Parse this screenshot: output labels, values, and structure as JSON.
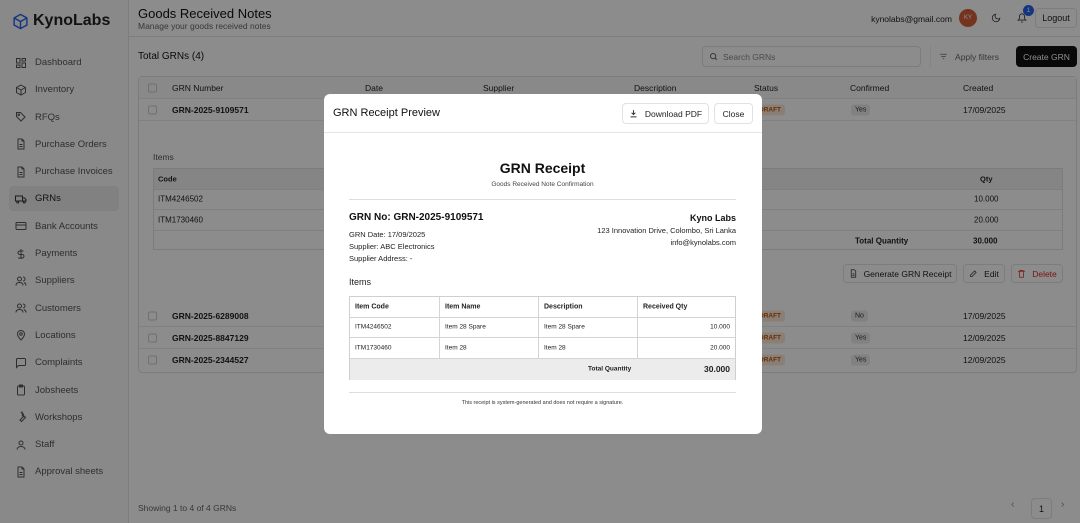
{
  "app": {
    "name": "KynoLabs"
  },
  "sidebar": {
    "items": [
      {
        "label": "Dashboard",
        "icon": "grid-icon"
      },
      {
        "label": "Inventory",
        "icon": "box-icon"
      },
      {
        "label": "RFQs",
        "icon": "tag-icon"
      },
      {
        "label": "Purchase Orders",
        "icon": "document-icon"
      },
      {
        "label": "Purchase Invoices",
        "icon": "document-icon"
      },
      {
        "label": "GRNs",
        "icon": "truck-icon",
        "active": true
      },
      {
        "label": "Bank Accounts",
        "icon": "card-icon"
      },
      {
        "label": "Payments",
        "icon": "dollar-icon"
      },
      {
        "label": "Suppliers",
        "icon": "users-icon"
      },
      {
        "label": "Customers",
        "icon": "users-icon"
      },
      {
        "label": "Locations",
        "icon": "pin-icon"
      },
      {
        "label": "Complaints",
        "icon": "chat-icon"
      },
      {
        "label": "Jobsheets",
        "icon": "clipboard-icon"
      },
      {
        "label": "Workshops",
        "icon": "wrench-icon"
      },
      {
        "label": "Staff",
        "icon": "user-icon"
      },
      {
        "label": "Approval sheets",
        "icon": "document-icon"
      }
    ]
  },
  "header": {
    "title": "Goods Received Notes",
    "subtitle": "Manage your goods received notes",
    "email": "kynolabs@gmail.com",
    "avatar_initials": "KY",
    "notification_count": "1",
    "logout_label": "Logout"
  },
  "toolbar": {
    "title": "Total GRNs (4)",
    "search_placeholder": "Search GRNs",
    "filters_label": "Apply filters",
    "create_label": "Create GRN"
  },
  "table": {
    "columns": [
      "GRN Number",
      "Date",
      "Supplier",
      "Description",
      "Status",
      "Confirmed",
      "Created"
    ],
    "rows": [
      {
        "grn": "GRN-2025-9109571",
        "status": "DRAFT",
        "confirmed": "Yes",
        "created": "17/09/2025"
      },
      {
        "grn": "GRN-2025-6289008",
        "status": "DRAFT",
        "confirmed": "No",
        "created": "17/09/2025"
      },
      {
        "grn": "GRN-2025-8847129",
        "status": "DRAFT",
        "confirmed": "Yes",
        "created": "12/09/2025"
      },
      {
        "grn": "GRN-2025-2344527",
        "status": "DRAFT",
        "confirmed": "Yes",
        "created": "12/09/2025"
      }
    ]
  },
  "expanded": {
    "items_label": "Items",
    "columns": [
      "Code",
      "Qty"
    ],
    "rows": [
      {
        "code": "ITM4246502",
        "qty": "10.000"
      },
      {
        "code": "ITM1730460",
        "qty": "20.000"
      }
    ],
    "total_label": "Total Quantity",
    "total_value": "30.000",
    "actions": {
      "generate": "Generate GRN Receipt",
      "edit": "Edit",
      "delete": "Delete"
    }
  },
  "footer": {
    "showing": "Showing 1 to 4 of 4 GRNs",
    "page": "1"
  },
  "modal": {
    "title": "GRN Receipt Preview",
    "download_label": "Download PDF",
    "close_label": "Close",
    "receipt": {
      "title": "GRN Receipt",
      "subtitle": "Goods Received Note Confirmation",
      "grn_no": "GRN No: GRN-2025-9109571",
      "grn_date": "GRN Date: 17/09/2025",
      "supplier": "Supplier: ABC Electronics",
      "supplier_address": "Supplier Address: -",
      "company": "Kyno Labs",
      "address": "123 Innovation Drive, Colombo, Sri Lanka",
      "email": "info@kynolabs.com",
      "items_label": "Items",
      "columns": [
        "Item Code",
        "Item Name",
        "Description",
        "Received Qty"
      ],
      "rows": [
        [
          "ITM4246502",
          "Item 28 Spare",
          "Item 28 Spare",
          "10.000"
        ],
        [
          "ITM1730460",
          "Item 28",
          "Item 28",
          "20.000"
        ]
      ],
      "total_label": "Total Quantity",
      "total_value": "30.000",
      "footer_note": "This receipt is system-generated and does not require a signature."
    }
  }
}
